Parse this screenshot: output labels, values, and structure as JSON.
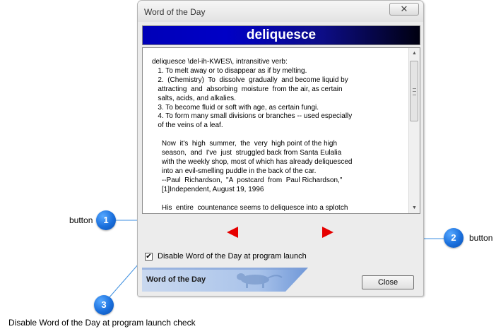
{
  "window": {
    "title": "Word of the Day",
    "close_glyph": "✕"
  },
  "banner": {
    "word": "deliquesce"
  },
  "definition": {
    "lines": [
      "deliquesce \\del-ih-KWES\\, intransitive verb:",
      "   1. To melt away or to disappear as if by melting.",
      "   2.  (Chemistry)  To  dissolve  gradually  and become liquid by",
      "   attracting  and  absorbing  moisture  from the air, as certain",
      "   salts, acids, and alkalies.",
      "   3. To become fluid or soft with age, as certain fungi.",
      "   4. To form many small divisions or branches -- used especially",
      "   of the veins of a leaf.",
      "",
      "     Now  it's  high  summer,  the  very  high point of the high",
      "     season,  and  I've  just  struggled back from Santa Eulalia",
      "     with the weekly shop, most of which has already deliquesced",
      "     into an evil-smelling puddle in the back of the car.",
      "     --Paul  Richardson,  \"A  postcard  from  Paul Richardson,\"",
      "     [1]Independent, August 19, 1996",
      "",
      "     His  entire  countenance seems to deliquesce into a splotch"
    ]
  },
  "scroll": {
    "up_glyph": "▲",
    "down_glyph": "▼"
  },
  "nav": {
    "prev_icon": "left-arrow-icon",
    "next_icon": "right-arrow-icon",
    "arrow_color": "#e60000"
  },
  "checkbox": {
    "label": "Disable Word of the Day at program launch",
    "checked": true,
    "mark": "✔"
  },
  "footer": {
    "label": "Word of the Day",
    "close_label": "Close"
  },
  "annotations": [
    {
      "number": "1",
      "text": "button"
    },
    {
      "number": "2",
      "text": "button"
    },
    {
      "number": "3",
      "text": "Disable Word of the Day at program launch check"
    }
  ],
  "colors": {
    "callout": "#1a6fdc",
    "callout_line": "#3b8ee0",
    "banner_start": "#0000c6",
    "banner_end": "#000010"
  }
}
